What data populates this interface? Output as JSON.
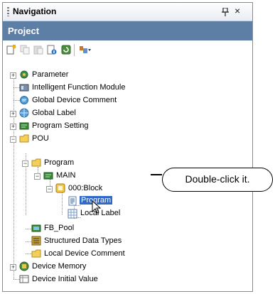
{
  "panel": {
    "title": "Navigation",
    "pin_glyph": "⭘",
    "close_glyph": "×"
  },
  "project": {
    "title": "Project"
  },
  "toolbar": {
    "icons": [
      "new-data-icon",
      "copy-icon",
      "paste-icon",
      "property-icon",
      "refresh-icon",
      "filter-icon"
    ]
  },
  "tree": {
    "parameter": "Parameter",
    "intelligent": "Intelligent Function Module",
    "global_device_comment": "Global Device Comment",
    "global_label": "Global Label",
    "program_setting": "Program Setting",
    "pou": "POU",
    "program_folder": "Program",
    "main": "MAIN",
    "block": "000:Block",
    "program_item": "Program",
    "local_label": "Local Label",
    "fb_pool": "FB_Pool",
    "structured_types": "Structured Data Types",
    "local_device_comment": "Local Device Comment",
    "device_memory": "Device Memory",
    "device_initial": "Device Initial Value"
  },
  "callout": {
    "text": "Double-click it."
  },
  "colors": {
    "project_bar": "#5d7fa6",
    "selection": "#3169c6"
  }
}
